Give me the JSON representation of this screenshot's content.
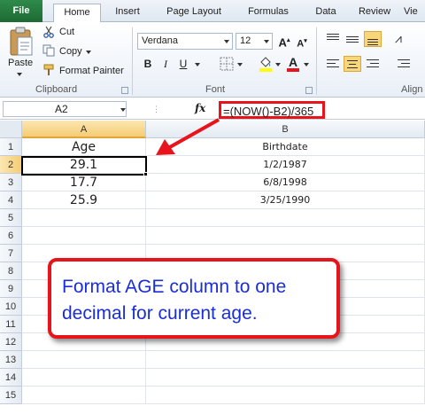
{
  "ribbon": {
    "tabs": [
      "File",
      "Home",
      "Insert",
      "Page Layout",
      "Formulas",
      "Data",
      "Review",
      "Vie"
    ],
    "active_tab": "Home",
    "clipboard": {
      "paste": "Paste",
      "cut": "Cut",
      "copy": "Copy",
      "format_painter": "Format Painter",
      "group_label": "Clipboard"
    },
    "font": {
      "name": "Verdana",
      "size": "12",
      "group_label": "Font"
    },
    "alignment": {
      "group_label": "Align"
    }
  },
  "formula_bar": {
    "name_box": "A2",
    "fx": "fx",
    "formula": "=(NOW()-B2)/365"
  },
  "sheet": {
    "columns": [
      "A",
      "B"
    ],
    "rows": [
      "1",
      "2",
      "3",
      "4",
      "5",
      "6",
      "7",
      "8",
      "9",
      "10",
      "11",
      "12",
      "13",
      "14",
      "15"
    ],
    "cells": [
      {
        "a": "Age",
        "b": "Birthdate"
      },
      {
        "a": "29.1",
        "b": "1/2/1987"
      },
      {
        "a": "17.7",
        "b": "6/8/1998"
      },
      {
        "a": "25.9",
        "b": "3/25/1990"
      }
    ],
    "selected_cell": "A2"
  },
  "callout": {
    "text": "Format AGE column to one decimal for current age."
  },
  "colors": {
    "highlight_border": "#e8141c",
    "callout_text": "#1a2ed6",
    "file_tab": "#1d6b33"
  }
}
